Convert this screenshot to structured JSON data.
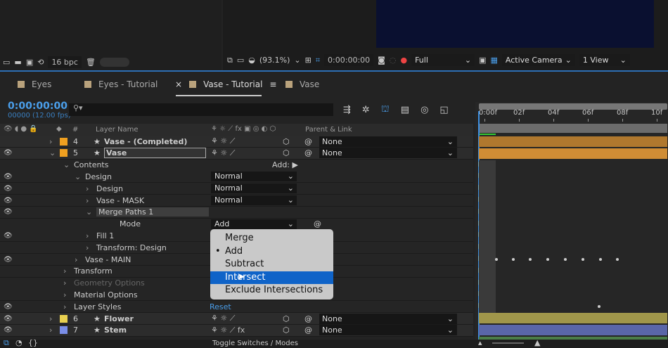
{
  "project_panel": {
    "bpc": "16 bpc"
  },
  "viewer": {
    "zoom": "(93.1%)",
    "timecode": "0:00:00:00",
    "resolution": "Full",
    "camera": "Active Camera",
    "views": "1 View"
  },
  "tabs": [
    {
      "label": "Eyes",
      "active": false
    },
    {
      "label": "Eyes - Tutorial",
      "active": false
    },
    {
      "label": "Vase - Tutorial",
      "active": true
    },
    {
      "label": "Vase",
      "active": false
    }
  ],
  "timeline": {
    "timecode": "0:00:00:00",
    "frames": "00000 (12.00 fps)",
    "search_placeholder": "",
    "ticks": [
      "0:00f",
      "02f",
      "04f",
      "06f",
      "08f",
      "10f"
    ],
    "toggle_label": "Toggle Switches / Modes"
  },
  "columns": {
    "num": "#",
    "layer_name": "Layer Name",
    "parent": "Parent & Link"
  },
  "layers": [
    {
      "num": "4",
      "name": "Vase - (Completed)",
      "color": "#f0a020",
      "parent": "None"
    },
    {
      "num": "5",
      "name": "Vase",
      "color": "#f0a020",
      "parent": "None"
    },
    {
      "num": "6",
      "name": "Flower",
      "color": "#e8d050",
      "parent": "None"
    },
    {
      "num": "7",
      "name": "Stem",
      "color": "#7a8ee8",
      "parent": "None"
    }
  ],
  "properties": {
    "contents": "Contents",
    "add_label": "Add:",
    "design": "Design",
    "design_mode": "Normal",
    "design_sub": "Design",
    "design_sub_mode": "Normal",
    "vase_mask": "Vase - MASK",
    "vase_mask_mode": "Normal",
    "merge_paths": "Merge Paths 1",
    "mode_label": "Mode",
    "mode_value": "Add",
    "fill": "Fill 1",
    "transform_design": "Transform: Design",
    "vase_main": "Vase - MAIN",
    "transform": "Transform",
    "geometry": "Geometry Options",
    "material": "Material Options",
    "layer_styles": "Layer Styles",
    "reset": "Reset"
  },
  "dropdown": {
    "items": [
      "Merge",
      "Add",
      "Subtract",
      "Intersect",
      "Exclude Intersections"
    ],
    "selected": "Add",
    "highlighted": "Intersect"
  }
}
